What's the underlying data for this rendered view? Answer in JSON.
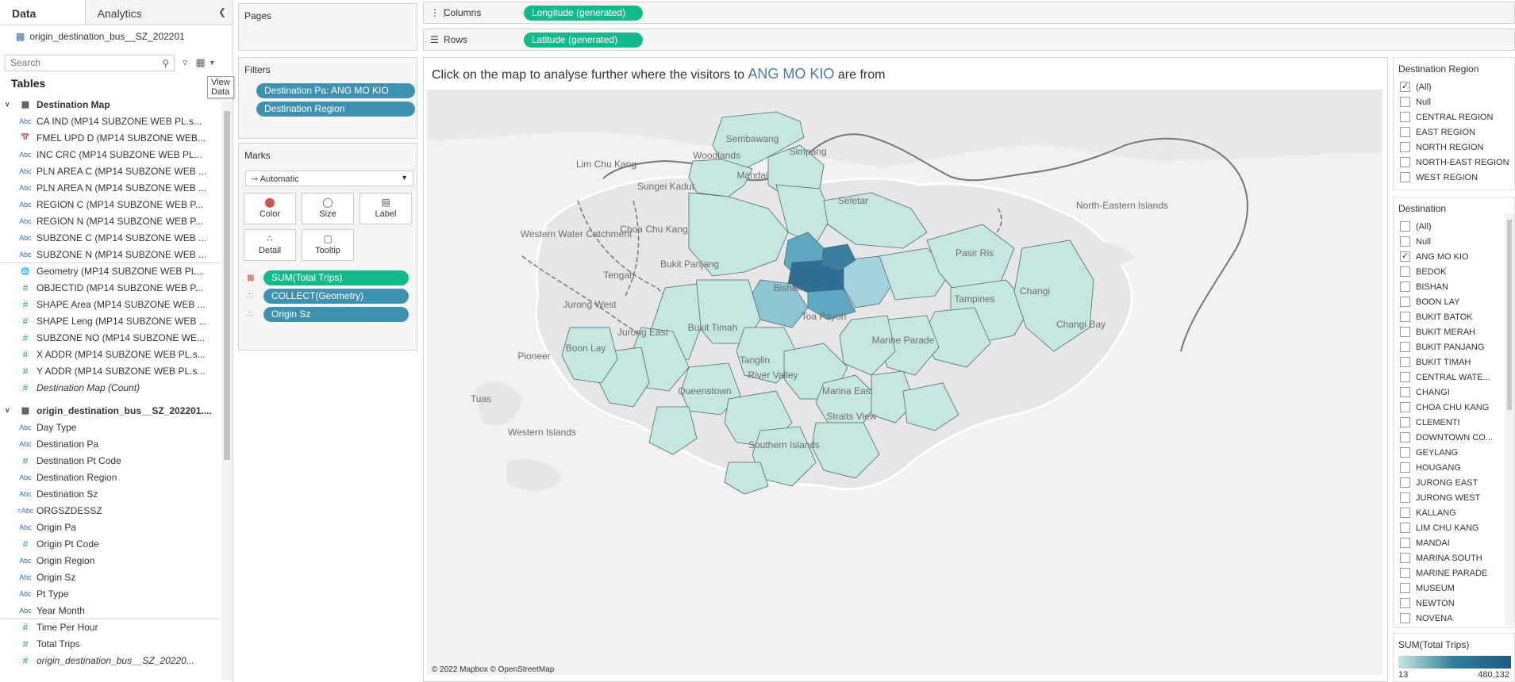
{
  "left": {
    "tabs": [
      "Data",
      "Analytics"
    ],
    "datasource": "origin_destination_bus__SZ_202201",
    "search_placeholder": "Search",
    "tables_heading": "Tables",
    "tooltip": "View Data",
    "groups": [
      {
        "name": "Destination Map",
        "fields": [
          {
            "icon": "Abc",
            "label": "CA IND (MP14 SUBZONE WEB PL.s..."
          },
          {
            "icon": "cal",
            "label": "FMEL UPD D (MP14 SUBZONE WEB..."
          },
          {
            "icon": "Abc",
            "label": "INC CRC (MP14 SUBZONE WEB PL..."
          },
          {
            "icon": "Abc",
            "label": "PLN AREA C (MP14 SUBZONE WEB ..."
          },
          {
            "icon": "Abc",
            "label": "PLN AREA N (MP14 SUBZONE WEB ..."
          },
          {
            "icon": "Abc",
            "label": "REGION C (MP14 SUBZONE WEB P..."
          },
          {
            "icon": "Abc",
            "label": "REGION N (MP14 SUBZONE WEB P..."
          },
          {
            "icon": "Abc",
            "label": "SUBZONE C (MP14 SUBZONE WEB ..."
          },
          {
            "icon": "Abc",
            "label": "SUBZONE N (MP14 SUBZONE WEB ..."
          },
          {
            "icon": "geo",
            "label": "Geometry (MP14 SUBZONE WEB PL...",
            "sep": true
          },
          {
            "icon": "#",
            "label": "OBJECTID (MP14 SUBZONE WEB P..."
          },
          {
            "icon": "#",
            "label": "SHAPE Area (MP14 SUBZONE WEB ..."
          },
          {
            "icon": "#",
            "label": "SHAPE Leng (MP14 SUBZONE WEB ..."
          },
          {
            "icon": "#",
            "label": "SUBZONE NO (MP14 SUBZONE WE..."
          },
          {
            "icon": "#",
            "label": "X ADDR (MP14 SUBZONE WEB PL.s..."
          },
          {
            "icon": "#",
            "label": "Y ADDR (MP14 SUBZONE WEB PL.s..."
          },
          {
            "icon": "#",
            "label": "Destination Map (Count)",
            "italic": true
          }
        ]
      },
      {
        "name": "origin_destination_bus__SZ_202201....",
        "fields": [
          {
            "icon": "Abc",
            "label": "Day Type"
          },
          {
            "icon": "Abc",
            "label": "Destination Pa"
          },
          {
            "icon": "#",
            "label": "Destination Pt Code"
          },
          {
            "icon": "Abc",
            "label": "Destination Region"
          },
          {
            "icon": "Abc",
            "label": "Destination Sz"
          },
          {
            "icon": "=Abc",
            "label": "ORGSZDESSZ"
          },
          {
            "icon": "Abc",
            "label": "Origin Pa"
          },
          {
            "icon": "#",
            "label": "Origin Pt Code"
          },
          {
            "icon": "Abc",
            "label": "Origin Region"
          },
          {
            "icon": "Abc",
            "label": "Origin Sz"
          },
          {
            "icon": "Abc",
            "label": "Pt Type"
          },
          {
            "icon": "Abc",
            "label": "Year Month"
          },
          {
            "icon": "#",
            "label": "Time Per Hour",
            "sep": true
          },
          {
            "icon": "#",
            "label": "Total Trips"
          },
          {
            "icon": "#",
            "label": "origin_destination_bus__SZ_20220...",
            "italic": true
          }
        ]
      }
    ]
  },
  "shelves": {
    "pages": "Pages",
    "filters_title": "Filters",
    "filters": [
      "Destination Pa: ANG MO KIO",
      "Destination Region"
    ],
    "marks_title": "Marks",
    "mark_type": "Automatic",
    "mark_buttons": [
      "Color",
      "Size",
      "Label",
      "Detail",
      "Tooltip"
    ],
    "mark_pills": [
      "SUM(Total Trips)",
      "COLLECT(Geometry)",
      "Origin Sz"
    ],
    "columns_label": "Columns",
    "columns_pill": "Longitude (generated)",
    "rows_label": "Rows",
    "rows_pill": "Latitude (generated)"
  },
  "sheet": {
    "title_pre": "Click on the map to analyse further where the visitors to ",
    "title_highlight": "ANG MO KIO",
    "title_post": " are from",
    "credit": "© 2022 Mapbox © OpenStreetMap",
    "place_labels": [
      "Sembawang",
      "Woodlands",
      "Simpang",
      "Lim Chu Kang",
      "Mandai",
      "Sungei Kadut",
      "Seletar",
      "North-Eastern Islands",
      "Western Water Catchment",
      "Choa Chu Kang",
      "Tengah",
      "Bukit Panjang",
      "Pasir Ris",
      "Jurong West",
      "Bishan",
      "Tampines",
      "Changi",
      "Jurong East",
      "Changi Bay",
      "Boon Lay",
      "Pioneer",
      "Bukit Timah",
      "Toa Payoh",
      "Tuas",
      "Tanglin",
      "Queenstown",
      "River Valley",
      "Marina East",
      "Marine Parade",
      "Western Islands",
      "Southern Islands",
      "Straits View"
    ]
  },
  "right": {
    "region_title": "Destination Region",
    "regions": [
      {
        "label": "(All)",
        "checked": true
      },
      {
        "label": "Null",
        "checked": false
      },
      {
        "label": "CENTRAL REGION",
        "checked": false
      },
      {
        "label": "EAST REGION",
        "checked": false
      },
      {
        "label": "NORTH REGION",
        "checked": false
      },
      {
        "label": "NORTH-EAST REGION",
        "checked": false
      },
      {
        "label": "WEST REGION",
        "checked": false
      }
    ],
    "dest_title": "Destination",
    "destinations": [
      {
        "label": "(All)",
        "checked": false
      },
      {
        "label": "Null",
        "checked": false
      },
      {
        "label": "ANG MO KIO",
        "checked": true
      },
      {
        "label": "BEDOK",
        "checked": false
      },
      {
        "label": "BISHAN",
        "checked": false
      },
      {
        "label": "BOON LAY",
        "checked": false
      },
      {
        "label": "BUKIT BATOK",
        "checked": false
      },
      {
        "label": "BUKIT MERAH",
        "checked": false
      },
      {
        "label": "BUKIT PANJANG",
        "checked": false
      },
      {
        "label": "BUKIT TIMAH",
        "checked": false
      },
      {
        "label": "CENTRAL WATE...",
        "checked": false
      },
      {
        "label": "CHANGI",
        "checked": false
      },
      {
        "label": "CHOA CHU KANG",
        "checked": false
      },
      {
        "label": "CLEMENTI",
        "checked": false
      },
      {
        "label": "DOWNTOWN CO...",
        "checked": false
      },
      {
        "label": "GEYLANG",
        "checked": false
      },
      {
        "label": "HOUGANG",
        "checked": false
      },
      {
        "label": "JURONG EAST",
        "checked": false
      },
      {
        "label": "JURONG WEST",
        "checked": false
      },
      {
        "label": "KALLANG",
        "checked": false
      },
      {
        "label": "LIM CHU KANG",
        "checked": false
      },
      {
        "label": "MANDAI",
        "checked": false
      },
      {
        "label": "MARINA SOUTH",
        "checked": false
      },
      {
        "label": "MARINE PARADE",
        "checked": false
      },
      {
        "label": "MUSEUM",
        "checked": false
      },
      {
        "label": "NEWTON",
        "checked": false
      },
      {
        "label": "NOVENA",
        "checked": false
      }
    ],
    "legend_title": "SUM(Total Trips)",
    "legend_min": "13",
    "legend_max": "480,132"
  },
  "colors": {
    "accent_green": "#14b98b",
    "pill_blue": "#3f91b0",
    "map_low": "#c8e6e3",
    "map_high": "#1e5a84"
  }
}
